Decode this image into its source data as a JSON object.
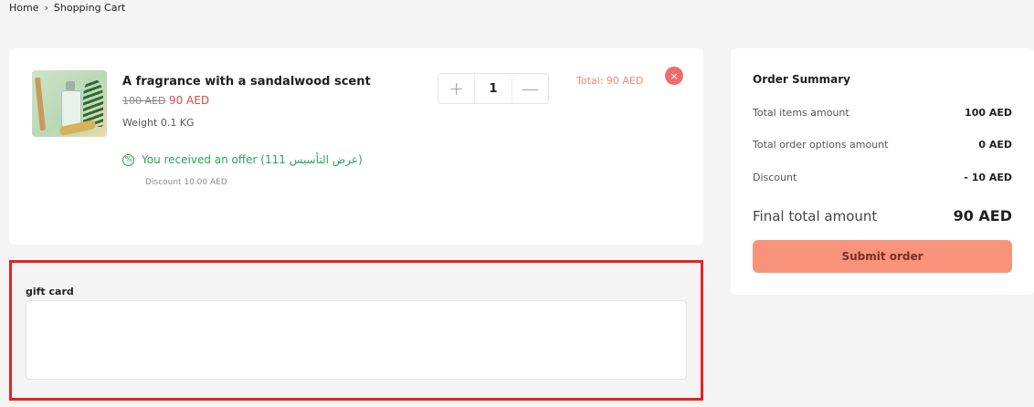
{
  "breadcrumb": {
    "home": "Home",
    "separator": "›",
    "current": "Shopping Cart"
  },
  "cart_item": {
    "name": "A fragrance with a sandalwood scent",
    "old_price": "100 AED",
    "new_price": "90 AED",
    "weight": "Weight 0.1 KG",
    "quantity": "1",
    "plus_symbol": "+",
    "minus_symbol": "—",
    "total": "Total: 90 AED",
    "remove_symbol": "×",
    "offer_text": "You received an offer (111 عرض التأسيس)",
    "discount_note": "Discount 10.00 AED",
    "offer_icon_symbol": "%"
  },
  "gift_card": {
    "label": "gift card",
    "value": "",
    "placeholder": ""
  },
  "summary": {
    "title": "Order Summary",
    "rows": [
      {
        "label": "Total items amount",
        "value": "100 AED"
      },
      {
        "label": "Total order options amount",
        "value": "0 AED"
      },
      {
        "label": "Discount",
        "value": "- 10 AED"
      }
    ],
    "final_label": "Final total amount",
    "final_value": "90 AED",
    "submit_label": "Submit order"
  },
  "colors": {
    "accent_button": "#f7937a",
    "price_red": "#e04b3f",
    "offer_green": "#27a45a",
    "total_orange": "#f08a6e",
    "remove_red": "#f26b6b",
    "highlight_border": "#e12424"
  }
}
